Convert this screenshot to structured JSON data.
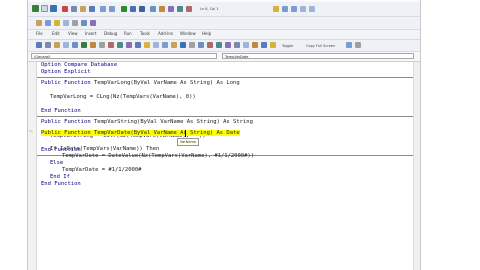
{
  "toolbar1": {
    "position_label": "Ln 6, Col 1"
  },
  "menu": [
    "File",
    "Edit",
    "View",
    "Insert",
    "Debug",
    "Run",
    "Tools",
    "Add-Ins",
    "Window",
    "Help"
  ],
  "format_bar": {
    "toggle_label": "Toggle",
    "copy_label": "Copy Full Screen"
  },
  "combos": {
    "object": "(General)",
    "procedure": "TempVarDate"
  },
  "code": {
    "option_compare": "Option Compare Database",
    "option_explicit": "Option Explicit",
    "long_sig_a": "Public Function ",
    "long_sig_b": "TempVarLong(ByVal VarName As String) As Long",
    "long_body": "TempVarLong = CLng(Nz(TempVars(VarName), 0))",
    "end_fn_1": "End Function",
    "str_sig_a": "Public Function ",
    "str_sig_b": "TempVarString(ByVal VarName As String) As String",
    "str_body": "TempVarString = CStr(Nz(TempVars(VarName), \"\"))",
    "end_fn_2": "End Function",
    "date_sig": "Public Function TempVarDate(ByVal VarName As String) As Date",
    "tooltip": "VarName",
    "if_line": "If IsDate(TempVars(VarName)) Then",
    "if_body": "TempVarDate = DateValue(Nz(TempVars(VarName), #1/1/2000#))",
    "else_line": "Else",
    "else_body": "TempVarDate = #1/1/2000#",
    "end_if": "End If",
    "end_fn_3": "End Function"
  },
  "colors": {
    "keyword": "#000080",
    "highlight": "#ffff00",
    "toolbar": "#eef1f6"
  }
}
